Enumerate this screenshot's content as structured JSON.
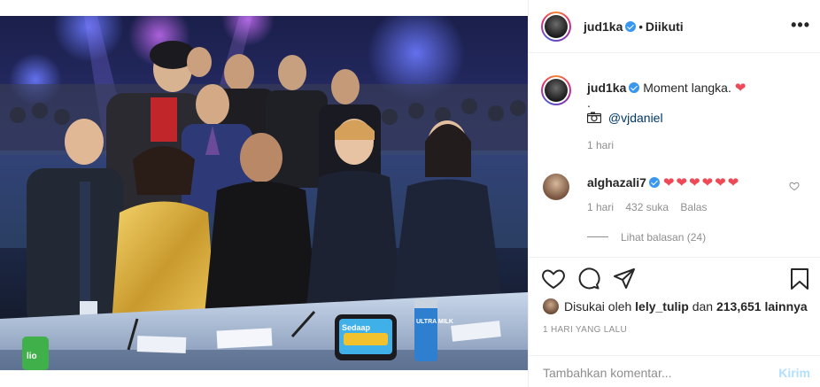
{
  "post": {
    "author": "jud1ka",
    "follow_status": "Diikuti",
    "more_icon": "•••"
  },
  "caption": {
    "username": "jud1ka",
    "text": "Moment langka.",
    "line2": ".",
    "tag_icon": "camera-icon",
    "mention": "@vjdaniel",
    "time": "1 hari"
  },
  "comment": {
    "username": "alghazali7",
    "hearts": "❤❤❤❤❤❤",
    "time": "1 hari",
    "likes": "432 suka",
    "reply": "Balas",
    "view_replies": "Lihat balasan (24)"
  },
  "likes": {
    "prefix": "Disukai oleh",
    "first_user": "lely_tulip",
    "middle": "dan",
    "count": "213,651 lainnya"
  },
  "timestamp": "1 HARI YANG LALU",
  "add_comment": {
    "placeholder": "Tambahkan komentar...",
    "send": "Kirim"
  },
  "photo_text": {
    "sign_left": "Sedaap",
    "cup_text": "ULTRA MILK",
    "bottle_text": "lio"
  },
  "colors": {
    "verified": "#3897f0",
    "heart": "#ed4956",
    "link": "#00376b",
    "send_disabled": "#b2dffc"
  }
}
